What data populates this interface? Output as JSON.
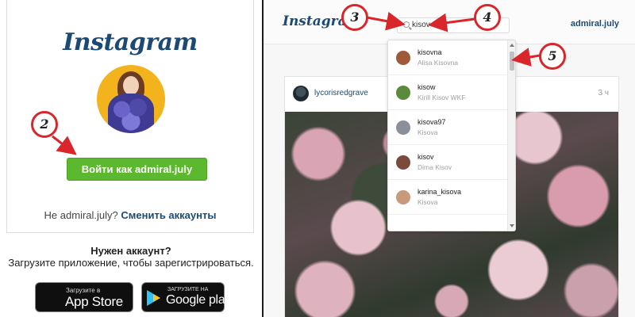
{
  "left_panel": {
    "logo": "Instagram",
    "login_button": "Войти как admiral.july",
    "not_user_prefix": "Не admiral.july?",
    "switch_accounts": "Сменить аккаунты",
    "need_account": "Нужен аккаунт?",
    "install_text": "Загрузите приложение, чтобы зарегистрироваться.",
    "app_store": {
      "small": "Загрузите в",
      "big": "App Store",
      "icon": "apple-icon"
    },
    "google_play": {
      "small": "ЗАГРУЗИТЕ НА",
      "big": "Google play",
      "icon": "google-play-icon"
    }
  },
  "right_panel": {
    "logo": "Instagram",
    "search": {
      "value": "kisov",
      "icon": "search-icon"
    },
    "username": "admiral.july",
    "post": {
      "user": "lycorisredgrave",
      "time": "3 ч"
    },
    "results": [
      {
        "name": "kisovna",
        "sub": "Alisa Kisovna",
        "color": "#a05a3a"
      },
      {
        "name": "kisow",
        "sub": "Kirill Kisov WKF",
        "color": "#5a8a3a"
      },
      {
        "name": "kisova97",
        "sub": "Kisova",
        "color": "#8a8f99"
      },
      {
        "name": "kisov",
        "sub": "Dima Kisov",
        "color": "#7a4a3a"
      },
      {
        "name": "karina_kisova",
        "sub": "Kisova",
        "color": "#c79a7a"
      }
    ]
  },
  "annotations": {
    "markers": [
      "2",
      "3",
      "4",
      "5"
    ],
    "color": "#d9262b"
  }
}
